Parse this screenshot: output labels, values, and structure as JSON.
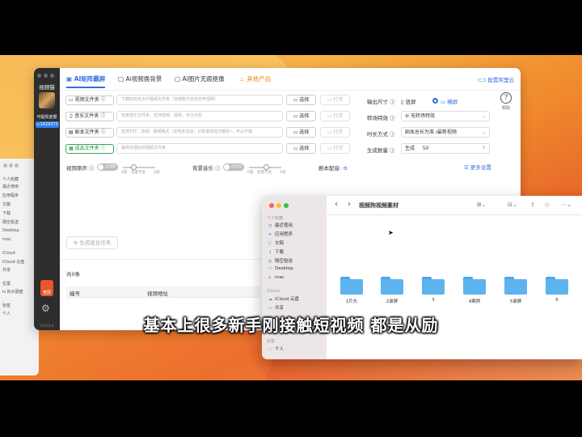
{
  "app": {
    "title": "视频猫",
    "sidebar": {
      "user_label": "可提现金额",
      "user_id": "≈1429373",
      "vip_label": "宽屏",
      "footer": "V1.9.0.0"
    },
    "tabs": [
      {
        "label": "AI矩阵霸屏",
        "icon": "grid-icon"
      },
      {
        "label": "Ai视频换背景",
        "icon": "image-icon"
      },
      {
        "label": "Ai图片无痕抠像",
        "icon": "image-icon"
      },
      {
        "label": "其他产品",
        "icon": "fire-icon"
      }
    ],
    "config_link": "配置阿里云",
    "help_label": "帮助",
    "rows": [
      {
        "label": "视频文件夹",
        "placeholder": "下载好的无水印视频文件夹（音频暂不支持无声视频）",
        "select": "选择",
        "open": "打开"
      },
      {
        "label": "音乐文件夹",
        "placeholder": "背景音乐文件夹，支持音频、视频，可以为空",
        "select": "选择",
        "open": "打开"
      },
      {
        "label": "剧本文件夹",
        "placeholder": "支持TXT、音频、视频格式（支持多音道，识别案例显示额外），可以不填",
        "select": "选择",
        "open": "打开"
      },
      {
        "label": "成品文件夹",
        "placeholder": "最终处理好的视频文件夹",
        "select": "选择",
        "open": "打开"
      }
    ],
    "right": {
      "output_size_label": "输出尺寸",
      "size_options": [
        "竖屏",
        "横屏"
      ],
      "transition_label": "转场特效",
      "transition_value": "无转场特效",
      "duration_label": "时长方式",
      "duration_value": "剧本总长为准 /最新视频",
      "count_label": "生成数量",
      "count_prefix": "生成",
      "count_value": "50",
      "more_settings": "更多设置"
    },
    "audio": {
      "video_sound_label": "视频原声",
      "video_sound_toggle": "启动原声",
      "bg_music_label": "背景音乐",
      "bg_music_toggle": "启动音乐",
      "script_voice_label": "剧本配音:",
      "scale_marks": [
        "0倍",
        "音量不变",
        "2倍"
      ]
    },
    "generate_button": "生成组合任务",
    "task_count": "共0条",
    "table_headers": [
      "编号",
      "视频地址"
    ]
  },
  "bg_finder": {
    "items": [
      "个人收藏",
      "最近使用",
      "应用程序",
      "文稿",
      "下载",
      "隔空投送",
      "Desktop",
      "mac",
      "iCloud",
      "iCloud 云盘",
      "共享",
      "位置",
      "ls 的大硬盘",
      "标签",
      "个人"
    ]
  },
  "finder": {
    "title": "视频狗视频素材",
    "sidebar_sections": [
      {
        "header": "个人收藏",
        "items": [
          "最近使用",
          "应用程序",
          "文稿",
          "下载",
          "隔空投送",
          "Desktop",
          "mac"
        ]
      },
      {
        "header": "iCloud",
        "items": [
          "iCloud 云盘",
          "共享"
        ]
      },
      {
        "header": "标签",
        "items": [
          "个人"
        ]
      }
    ],
    "folders": [
      "1片头",
      "2录屏",
      "3",
      "4案例",
      "5录屏",
      "6"
    ]
  },
  "subtitle": "基本上很多新手刚接触短视频 都是从励",
  "colors": {
    "accent": "#2f6fdf",
    "orange": "#e98a1a",
    "folder": "#5cb3ee"
  }
}
